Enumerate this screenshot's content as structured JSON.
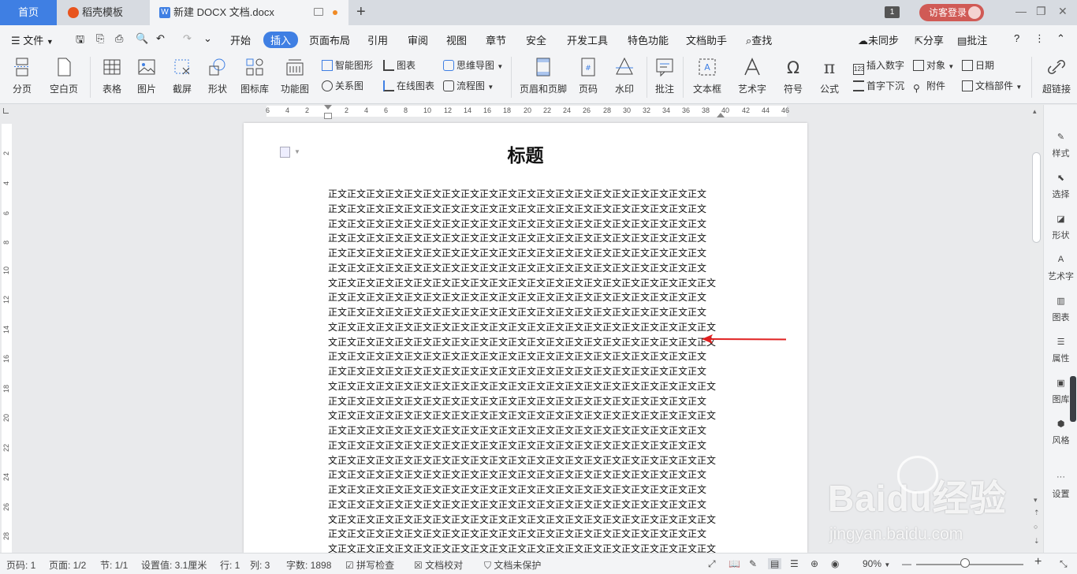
{
  "tabs": {
    "home": "首页",
    "daoke": "稻壳模板",
    "doc": "新建 DOCX 文档.docx",
    "window_count": "1",
    "login": "访客登录"
  },
  "menubar": {
    "file": "文件",
    "items": [
      "开始",
      "插入",
      "页面布局",
      "引用",
      "审阅",
      "视图",
      "章节",
      "安全",
      "开发工具",
      "特色功能",
      "文档助手"
    ],
    "search": "查找",
    "unsynced": "未同步",
    "share": "分享",
    "comment": "批注"
  },
  "ribbon": {
    "page_break": "分页",
    "blank_page": "空白页",
    "table": "表格",
    "picture": "图片",
    "screenshot": "截屏",
    "shape": "形状",
    "icon_lib": "图标库",
    "func_chart": "功能图",
    "smart_art": "智能图形",
    "chart": "图表",
    "relation": "关系图",
    "online_chart": "在线图表",
    "mindmap": "思维导图",
    "flowchart": "流程图",
    "header_footer": "页眉和页脚",
    "page_num": "页码",
    "watermark": "水印",
    "comment": "批注",
    "textbox": "文本框",
    "wordart": "艺术字",
    "symbol": "符号",
    "formula": "公式",
    "insert_number": "插入数字",
    "drop_cap": "首字下沉",
    "object": "对象",
    "attachment": "附件",
    "date": "日期",
    "doc_parts": "文档部件",
    "hyperlink": "超链接"
  },
  "ruler": {
    "h_ticks": [
      "6",
      "4",
      "2",
      "2",
      "4",
      "6",
      "8",
      "10",
      "12",
      "14",
      "16",
      "18",
      "20",
      "22",
      "24",
      "26",
      "28",
      "30",
      "32",
      "34",
      "36",
      "38",
      "40",
      "42",
      "44",
      "46"
    ],
    "v_ticks": [
      "2",
      "4",
      "6",
      "8",
      "10",
      "12",
      "14",
      "16",
      "18",
      "20",
      "22",
      "24",
      "26",
      "28"
    ]
  },
  "document": {
    "title": "标题",
    "lines": [
      "正文正文正文正文正文正文正文正文正文正文正文正文正文正文正文正文正文正文正文正文",
      "正文正文正文正文正文正文正文正文正文正文正文正文正文正文正文正文正文正文正文正文",
      "正文正文正文正文正文正文正文正文正文正文正文正文正文正文正文正文正文正文正文正文",
      "正文正文正文正文正文正文正文正文正文正文正文正文正文正文正文正文正文正文正文正文",
      "正文正文正文正文正文正文正文正文正文正文正文正文正文正文正文正文正文正文正文正文",
      "正文正文正文正文正文正文正文正文正文正文正文正文正文正文正文正文正文正文正文正文",
      "文正文正文正文正文正文正文正文正文正文正文正文正文正文正文正文正文正文正文正文正文",
      "正文正文正文正文正文正文正文正文正文正文正文正文正文正文正文正文正文正文正文正文",
      "正文正文正文正文正文正文正文正文正文正文正文正文正文正文正文正文正文正文正文正文",
      "文正文正文正文正文正文正文正文正文正文正文正文正文正文正文正文正文正文正文正文正文",
      "文正文正文正文正文正文正文正文正文正文正文正文正文正文正文正文正文正文正文正文正文",
      "正文正文正文正文正文正文正文正文正文正文正文正文正文正文正文正文正文正文正文正文",
      "正文正文正文正文正文正文正文正文正文正文正文正文正文正文正文正文正文正文正文正文",
      "文正文正文正文正文正文正文正文正文正文正文正文正文正文正文正文正文正文正文正文正文",
      "正文正文正文正文正文正文正文正文正文正文正文正文正文正文正文正文正文正文正文正文",
      "文正文正文正文正文正文正文正文正文正文正文正文正文正文正文正文正文正文正文正文正文",
      "正文正文正文正文正文正文正文正文正文正文正文正文正文正文正文正文正文正文正文正文",
      "正文正文正文正文正文正文正文正文正文正文正文正文正文正文正文正文正文正文正文正文",
      "文正文正文正文正文正文正文正文正文正文正文正文正文正文正文正文正文正文正文正文正文",
      "正文正文正文正文正文正文正文正文正文正文正文正文正文正文正文正文正文正文正文正文",
      "正文正文正文正文正文正文正文正文正文正文正文正文正文正文正文正文正文正文正文正文",
      "正文正文正文正文正文正文正文正文正文正文正文正文正文正文正文正文正文正文正文正文",
      "文正文正文正文正文正文正文正文正文正文正文正文正文正文正文正文正文正文正文正文正文",
      "正文正文正文正文正文正文正文正文正文正文正文正文正文正文正文正文正文正文正文正文",
      "文正文正文正文正文正文正文正文正文正文正文正文正文正文正文正文正文正文正文正文正文"
    ]
  },
  "sidebar": [
    "样式",
    "选择",
    "形状",
    "艺术字",
    "图表",
    "属性",
    "图库",
    "风格",
    "设置"
  ],
  "status": {
    "page_num": "页码: 1",
    "pages": "页面: 1/2",
    "section": "节: 1/1",
    "setting": "设置值: 3.1厘米",
    "row": "行: 1",
    "col": "列: 3",
    "word_count": "字数: 1898",
    "spellcheck": "拼写检查",
    "proofread": "文档校对",
    "unprotected": "文档未保护",
    "zoom": "90%"
  },
  "watermark_text": {
    "brand": "Baidu经验",
    "url": "jingyan.baidu.com"
  },
  "colors": {
    "accent": "#3f7fe3",
    "arrow": "#e02020",
    "login_bg": "#d05a55"
  }
}
